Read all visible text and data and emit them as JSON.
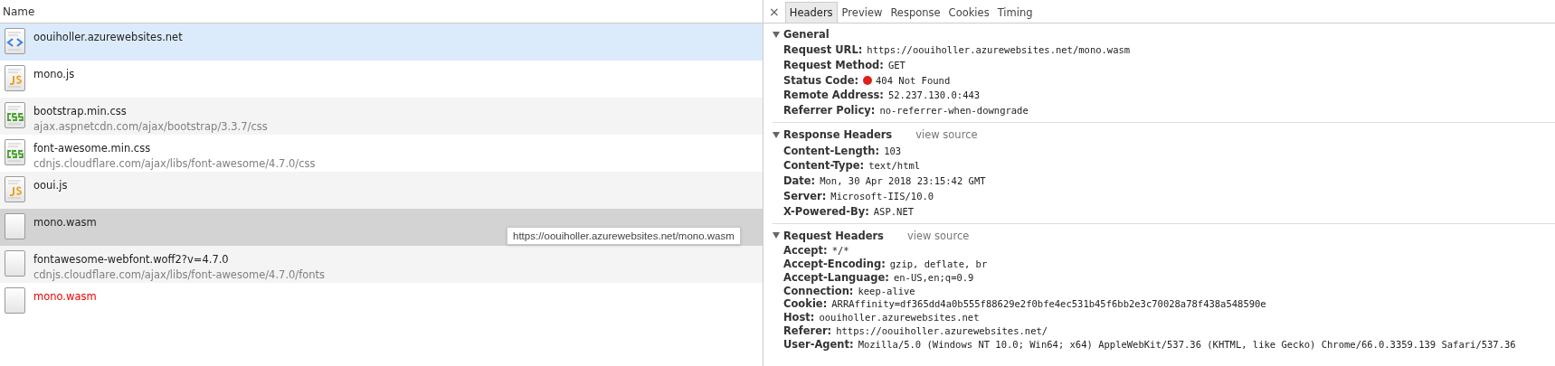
{
  "requests": {
    "column": "Name",
    "rows": [
      {
        "name": "oouiholler.azurewebsites.net",
        "kind": "html",
        "selected": true,
        "hovered": false,
        "error": false
      },
      {
        "name": "mono.js",
        "kind": "js",
        "selected": false,
        "hovered": false,
        "error": false
      },
      {
        "name": "bootstrap.min.css",
        "path": "ajax.aspnetcdn.com/ajax/bootstrap/3.3.7/css",
        "kind": "css",
        "selected": false,
        "hovered": false,
        "error": false
      },
      {
        "name": "font-awesome.min.css",
        "path": "cdnjs.cloudflare.com/ajax/libs/font-awesome/4.7.0/css",
        "kind": "css",
        "selected": false,
        "hovered": false,
        "error": false
      },
      {
        "name": "ooui.js",
        "kind": "js",
        "selected": false,
        "hovered": false,
        "error": false
      },
      {
        "name": "mono.wasm",
        "kind": "blank",
        "selected": false,
        "hovered": true,
        "error": false
      },
      {
        "name": "fontawesome-webfont.woff2?v=4.7.0",
        "path": "cdnjs.cloudflare.com/ajax/libs/font-awesome/4.7.0/fonts",
        "kind": "blank",
        "selected": false,
        "hovered": false,
        "error": false
      },
      {
        "name": "mono.wasm",
        "kind": "blank",
        "selected": false,
        "hovered": false,
        "error": true
      }
    ],
    "tooltip": "https://oouiholler.azurewebsites.net/mono.wasm"
  },
  "details": {
    "close": "×",
    "tabs": [
      {
        "label": "Headers",
        "selected": true
      },
      {
        "label": "Preview",
        "selected": false
      },
      {
        "label": "Response",
        "selected": false
      },
      {
        "label": "Cookies",
        "selected": false
      },
      {
        "label": "Timing",
        "selected": false
      }
    ],
    "sections": [
      {
        "title": "General",
        "expanded": true,
        "fields": [
          {
            "name": "Request URL:",
            "value": "https://oouiholler.azurewebsites.net/mono.wasm"
          },
          {
            "name": "Request Method:",
            "value": "GET"
          },
          {
            "name": "Status Code:",
            "value": "404 Not Found",
            "kind": "error-status"
          },
          {
            "name": "Remote Address:",
            "value": "52.237.130.0:443"
          },
          {
            "name": "Referrer Policy:",
            "value": "no-referrer-when-downgrade"
          }
        ]
      },
      {
        "title": "Response Headers",
        "expanded": true,
        "link": "view source",
        "fields": [
          {
            "name": "Content-Length:",
            "value": "103"
          },
          {
            "name": "Content-Type:",
            "value": "text/html"
          },
          {
            "name": "Date:",
            "value": "Mon, 30 Apr 2018 23:15:42 GMT"
          },
          {
            "name": "Server:",
            "value": "Microsoft-IIS/10.0"
          },
          {
            "name": "X-Powered-By:",
            "value": "ASP.NET"
          }
        ]
      },
      {
        "title": "Request Headers",
        "expanded": true,
        "link": "view source",
        "fields": [
          {
            "name": "Accept:",
            "value": "*/*"
          },
          {
            "name": "Accept-Encoding:",
            "value": "gzip, deflate, br"
          },
          {
            "name": "Accept-Language:",
            "value": "en-US,en;q=0.9"
          },
          {
            "name": "Connection:",
            "value": "keep-alive"
          },
          {
            "name": "Cookie:",
            "value": "ARRAffinity=df365dd4a0b555f88629e2f0bfe4ec531b45f6bb2e3c70028a78f438a548590e"
          },
          {
            "name": "Host:",
            "value": "oouiholler.azurewebsites.net"
          },
          {
            "name": "Referer:",
            "value": "https://oouiholler.azurewebsites.net/"
          },
          {
            "name": "User-Agent:",
            "value": "Mozilla/5.0 (Windows NT 10.0; Win64; x64) AppleWebKit/537.36 (KHTML, like Gecko) Chrome/66.0.3359.139 Safari/537.36"
          }
        ]
      }
    ]
  }
}
